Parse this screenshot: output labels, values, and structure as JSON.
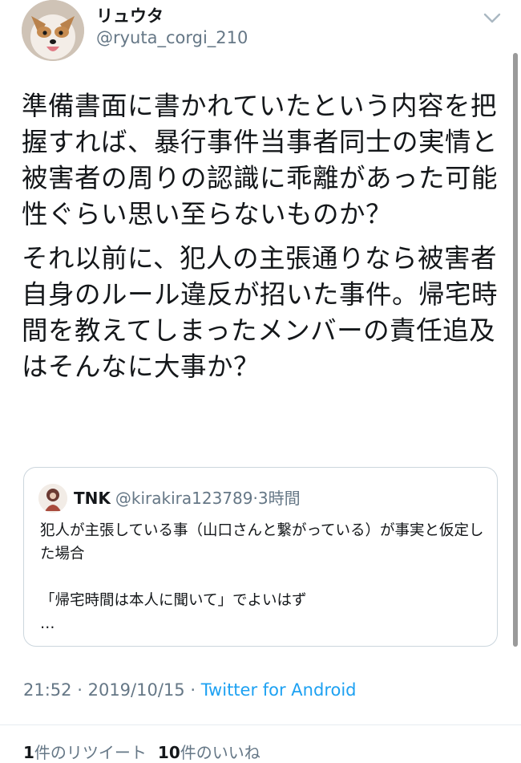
{
  "author": {
    "display_name": "リュウタ",
    "handle": "@ryuta_corgi_210",
    "avatar_icon": "corgi-avatar"
  },
  "menu_icon": "chevron-down-icon",
  "tweet": {
    "paragraphs": [
      "準備書面に書かれていたという内容を把握すれば、暴行事件当事者同士の実情と被害者の周りの認識に乖離があった可能性ぐらい思い至らないものか？",
      "それ以前に、犯人の主張通りなら被害者自身のルール違反が招いた事件。帰宅時間を教えてしまったメンバーの責任追及はそんなに大事か？"
    ]
  },
  "quoted": {
    "name": "TNK",
    "handle": "@kirakira123789",
    "separator": "·",
    "time": "3時間",
    "lines": [
      "犯人が主張している事（山口さんと繋がっている）が事実と仮定した場合",
      "",
      "「帰宅時間は本人に聞いて」でよいはず",
      "…"
    ]
  },
  "meta": {
    "time": "21:52",
    "separator": "·",
    "date": "2019/10/15",
    "source": "Twitter for Android"
  },
  "stats": {
    "retweet_count": "1",
    "retweet_label": "件のリツイート",
    "like_count": "10",
    "like_label": "件のいいね"
  },
  "colors": {
    "link": "#1da1f2",
    "secondary_text": "#657786",
    "border": "#ccd6dd"
  }
}
